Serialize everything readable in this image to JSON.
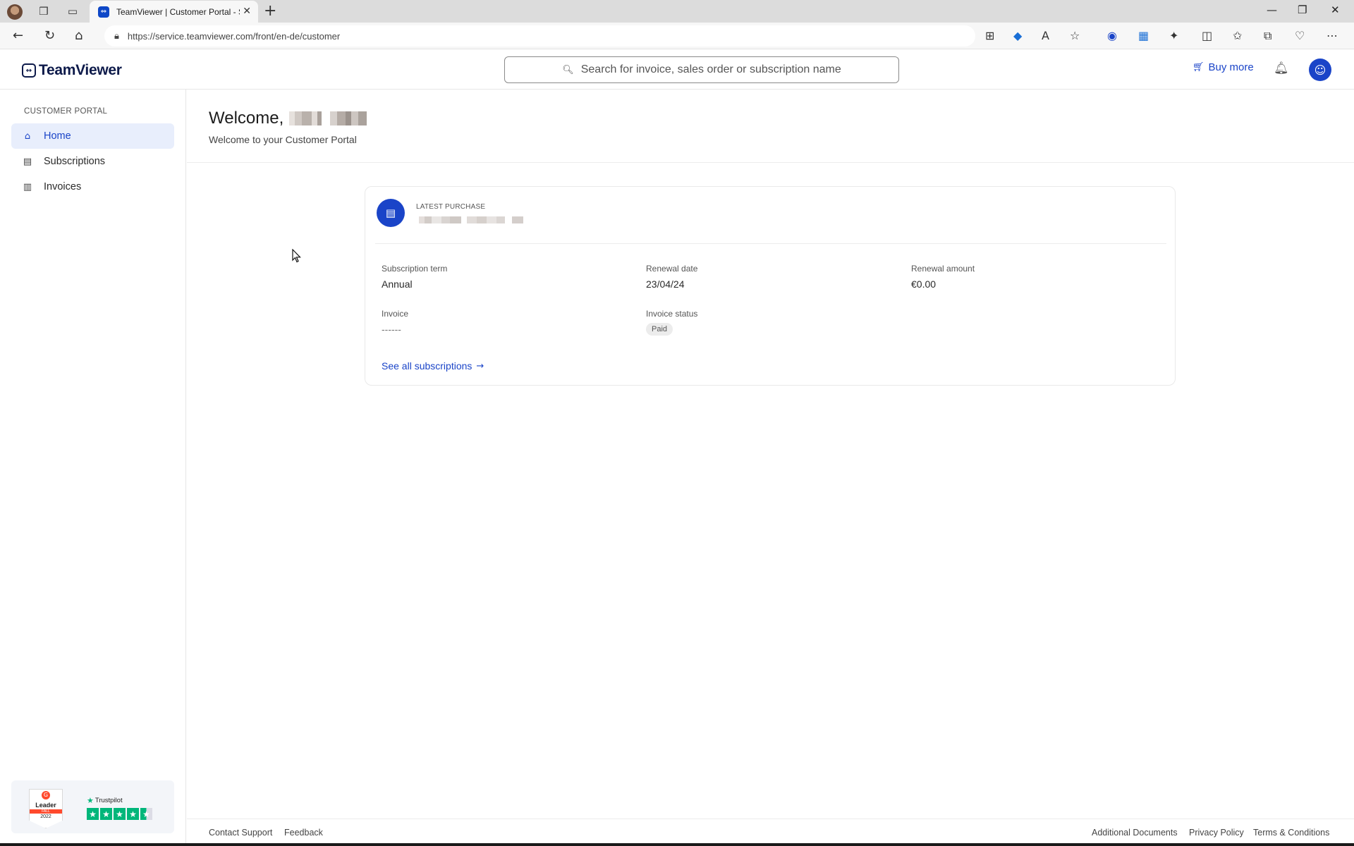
{
  "browser": {
    "tab_title": "TeamViewer | Customer Portal - S",
    "url": "https://service.teamviewer.com/front/en-de/customer",
    "icons": [
      "profile-avatar",
      "workspaces-icon",
      "tab-actions-icon",
      "back-icon",
      "refresh-icon",
      "home-icon",
      "lock-icon",
      "apps-icon",
      "tag-icon",
      "read-aloud-icon",
      "favorite-star-icon",
      "extension-icons",
      "split-screen-icon",
      "favorites-icon",
      "collections-icon",
      "performance-icon",
      "menu-dots-icon"
    ]
  },
  "header": {
    "logo_text": "TeamViewer",
    "search_placeholder": "Search for invoice, sales order or subscription name",
    "buy_more": "Buy more"
  },
  "sidebar": {
    "heading": "CUSTOMER PORTAL",
    "items": [
      {
        "label": "Home",
        "icon": "home-icon",
        "active": true
      },
      {
        "label": "Subscriptions",
        "icon": "clipboard-icon",
        "active": false
      },
      {
        "label": "Invoices",
        "icon": "receipt-icon",
        "active": false
      }
    ],
    "badges": {
      "g2_logo": "G",
      "g2_title": "Leader",
      "g2_season": "FALL",
      "g2_year": "2022",
      "trustpilot": "Trustpilot"
    }
  },
  "main": {
    "welcome": "Welcome,",
    "welcome_sub": "Welcome to your Customer Portal",
    "card": {
      "latest_purchase_label": "LATEST PURCHASE",
      "fields": [
        {
          "label": "Subscription term",
          "value": "Annual"
        },
        {
          "label": "Renewal date",
          "value": "23/04/24"
        },
        {
          "label": "Renewal amount",
          "value": "€0.00"
        },
        {
          "label": "Invoice",
          "value": "------"
        },
        {
          "label": "Invoice status",
          "value": "Paid"
        }
      ],
      "see_all": "See all subscriptions"
    }
  },
  "footer": {
    "left": [
      "Contact Support",
      "Feedback"
    ],
    "right": [
      "Additional Documents",
      "Privacy Policy",
      "Terms & Conditions"
    ]
  },
  "colors": {
    "accent": "#1a44c8",
    "active_bg": "#e8eefc",
    "logo": "#0d1a4a",
    "trustpilot_green": "#00b67a",
    "g2_red": "#ff492c"
  }
}
